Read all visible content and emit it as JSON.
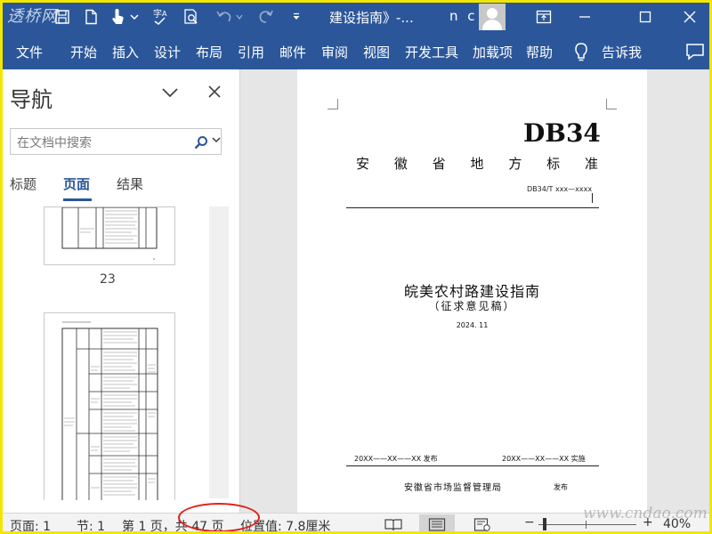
{
  "titlebar": {
    "logo_text": "透桥网",
    "document_title": "建设指南》-...",
    "user_initials": "n c",
    "icons": [
      "save-icon",
      "touch-mode-icon",
      "customize-chevron-icon",
      "spelling-icon",
      "print-preview-icon",
      "undo-icon",
      "redo-icon",
      "customize-qat-icon"
    ]
  },
  "ribbon": {
    "tabs": [
      "文件",
      "开始",
      "插入",
      "设计",
      "布局",
      "引用",
      "邮件",
      "审阅",
      "视图",
      "开发工具",
      "加载项",
      "帮助"
    ],
    "tell_me": "告诉我"
  },
  "navigation": {
    "title": "导航",
    "search_placeholder": "在文档中搜索",
    "tabs": [
      "标题",
      "页面",
      "结果"
    ],
    "active_tab": "页面",
    "page_label": "23"
  },
  "document": {
    "code": "DB34",
    "standard_name": [
      "安",
      "徽",
      "省",
      "地",
      "方",
      "标",
      "准"
    ],
    "standard_number": "DB34/T xxx—xxxx",
    "title": "皖美农村路建设指南",
    "subtitle": "（征求意见稿）",
    "date": "2024. 11",
    "publish_date": "20XX——XX——XX 发布",
    "implement_date": "20XX——XX——XX 实施",
    "issuer": "安徽省市场监督管理局",
    "issuer_suffix": "发布"
  },
  "statusbar": {
    "page": "页面: 1",
    "section": "节: 1",
    "page_count": "第 1 页，共 47 页",
    "position": "位置值: 7.8厘米",
    "zoom": "40%",
    "zoom_minus": "−",
    "zoom_plus": "+",
    "watermark": "www.cndao.com"
  },
  "colors": {
    "accent": "#2b579a",
    "highlight_frame": "#f2e600",
    "annotation": "#e0201b"
  }
}
